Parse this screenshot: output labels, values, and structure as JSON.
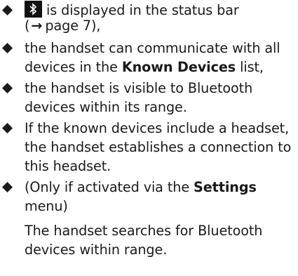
{
  "items": [
    {
      "icon": "bluetooth-icon",
      "line1_text": "is displayed in the status bar",
      "line2_open": "(",
      "line2_arrow": "→",
      "line2_ref": "page 7),"
    },
    {
      "line1": "the handset can communicate with all",
      "line2_pre": "devices in the ",
      "line2_bold": "Known Devices",
      "line2_post": " list,"
    },
    {
      "line1": "the handset is visible to Bluetooth",
      "line2": "devices within its range."
    },
    {
      "line1": "If the known devices include a headset,",
      "line2": "the handset establishes a connection to",
      "line3": "this headset."
    },
    {
      "line1_pre": "(Only if activated via the ",
      "line1_bold": "Settings",
      "line2": "menu)",
      "line3": "The handset searches for Bluetooth",
      "line4": "devices within range."
    }
  ],
  "colors": {
    "text": "#1a1a1a",
    "icon_bg": "#111111",
    "icon_fg": "#ffffff"
  }
}
